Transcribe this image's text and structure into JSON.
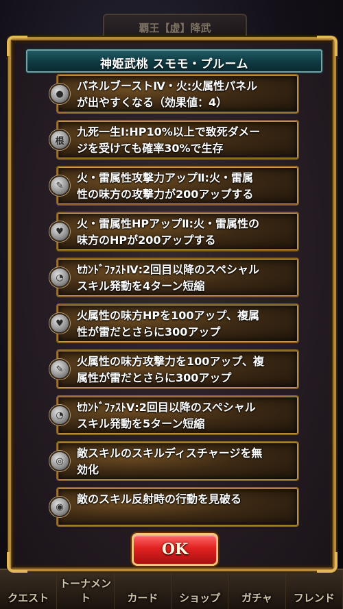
{
  "background": {
    "top_label": "覇王【虚】降武",
    "nav": [
      "クエスト",
      "トーナメント",
      "カード",
      "ショップ",
      "ガチャ",
      "フレンド"
    ]
  },
  "dialog": {
    "title": "神姫武桃 スモモ・プルーム",
    "skills": [
      {
        "icon": "panel-boost-icon",
        "glyph": "●",
        "text": "パネルブーストⅣ・火:火属性パネル\nが出やすくなる（効果値：4）"
      },
      {
        "icon": "nine-deaths-icon",
        "glyph": "根",
        "text": "九死一生Ⅰ:HP10%以上で致死ダメー\nジを受けても確率30%で生存"
      },
      {
        "icon": "attack-up-icon",
        "glyph": "✎",
        "text": "火・雷属性攻撃力アップⅡ:火・雷属\n性の味方の攻撃力が200アップする"
      },
      {
        "icon": "hp-up-icon",
        "glyph": "♥",
        "text": "火・雷属性HPアップⅡ:火・雷属性の\n味方のHPが200アップする"
      },
      {
        "icon": "second-fast-icon",
        "glyph": "◔",
        "text": "ｾｶﾝﾄﾞﾌｧｽﾄⅣ:2回目以降のスペシャル\nスキル発動を4ターン短縮"
      },
      {
        "icon": "hp-up-icon",
        "glyph": "♥",
        "text": "火属性の味方HPを100アップ、複属\n性が雷だとさらに300アップ"
      },
      {
        "icon": "attack-up-icon",
        "glyph": "✎",
        "text": "火属性の味方攻撃力を100アップ、複\n属性が雷だとさらに300アップ"
      },
      {
        "icon": "second-fast-icon",
        "glyph": "◔",
        "text": "ｾｶﾝﾄﾞﾌｧｽﾄⅤ:2回目以降のスペシャル\nスキル発動を5ターン短縮"
      },
      {
        "icon": "discharge-nullify-icon",
        "glyph": "◎",
        "text": "敵スキルのスキルディスチャージを無\n効化"
      },
      {
        "icon": "eye-icon",
        "glyph": "◉",
        "text": "敵のスキル反射時の行動を見破る"
      }
    ],
    "ok_label": "OK"
  }
}
